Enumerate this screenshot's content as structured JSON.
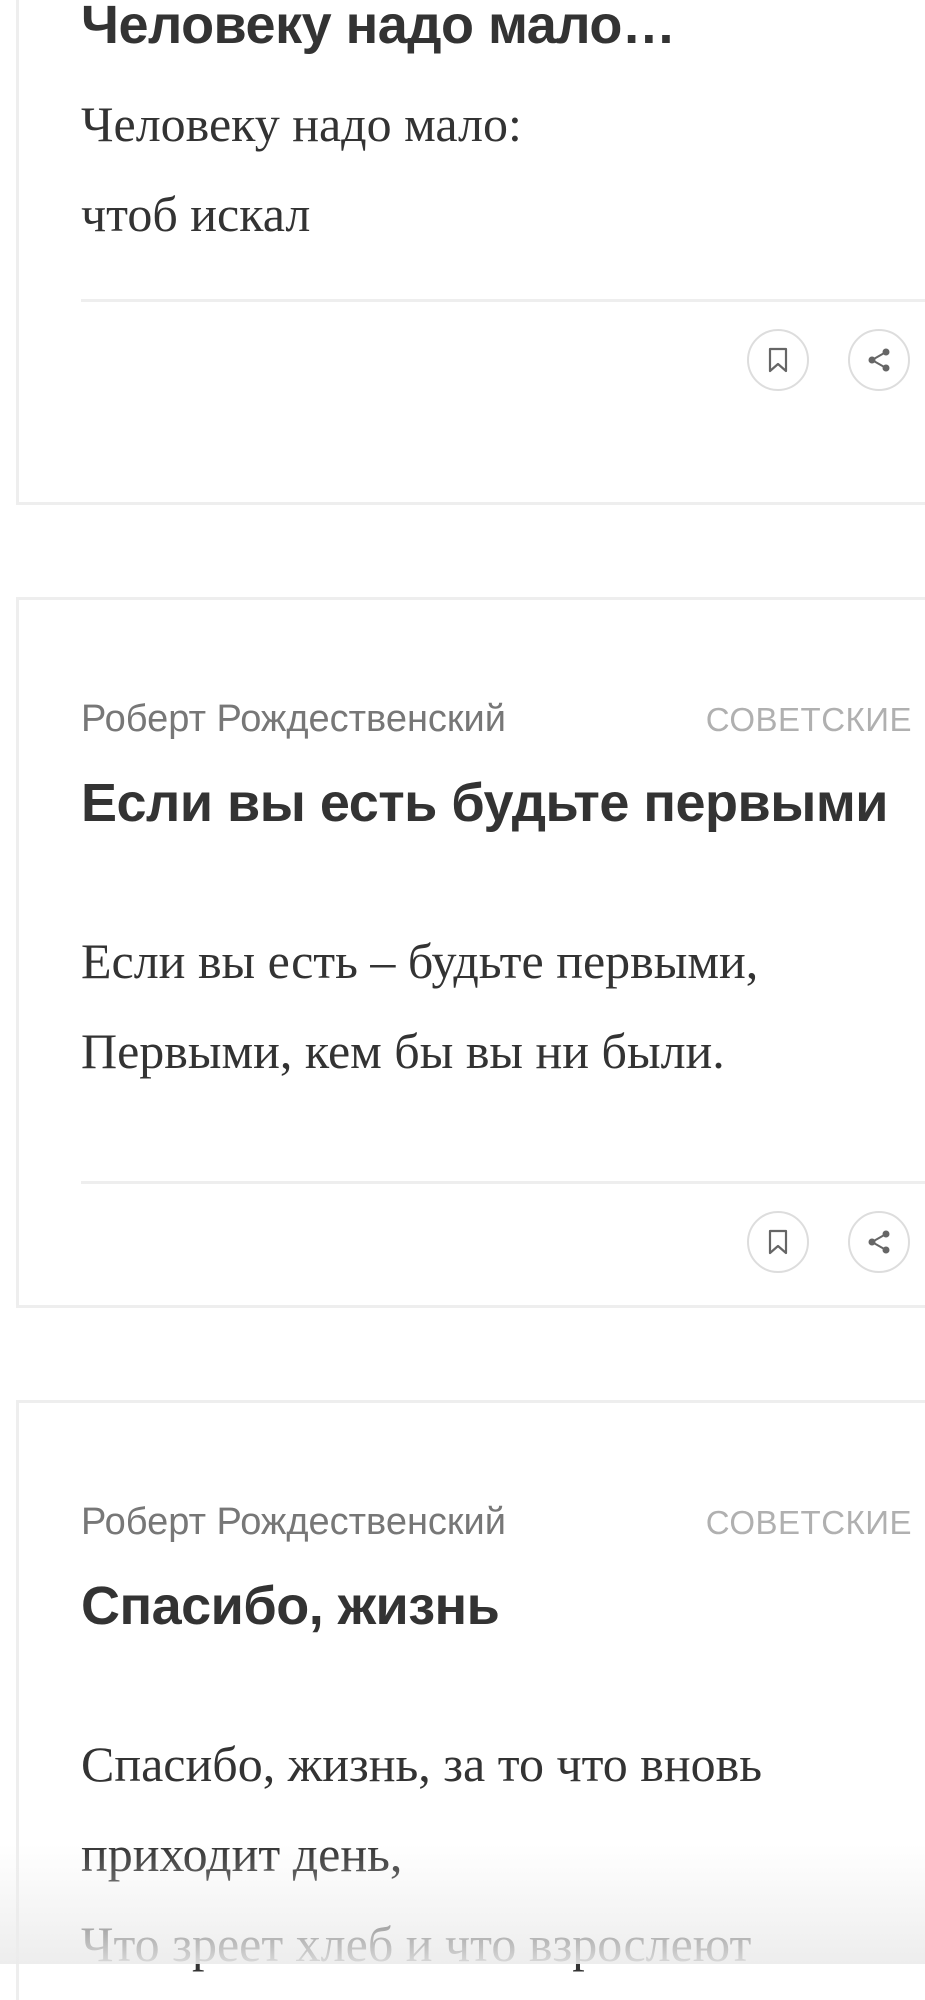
{
  "cards": [
    {
      "title": "Человеку надо мало…",
      "lines": [
        "Человеку надо мало:",
        "чтоб искал"
      ]
    },
    {
      "author": "Роберт Рождественский",
      "category": "СОВЕТСКИЕ",
      "title": "Если вы есть будьте первыми",
      "lines": [
        "Если вы есть – будьте первыми,",
        "Первыми, кем бы вы ни были."
      ]
    },
    {
      "author": "Роберт Рождественский",
      "category": "СОВЕТСКИЕ",
      "title": "Спасибо, жизнь",
      "lines": [
        "Спасибо, жизнь, за то что вновь",
        "приходит день,",
        "Что зреет хлеб и что взрослеют"
      ]
    }
  ],
  "icons": {
    "bookmark": "bookmark-icon",
    "share": "share-icon"
  },
  "colors": {
    "text": "#333333",
    "author": "#777777",
    "category": "#b0b0b0",
    "border": "#eeeeee"
  }
}
